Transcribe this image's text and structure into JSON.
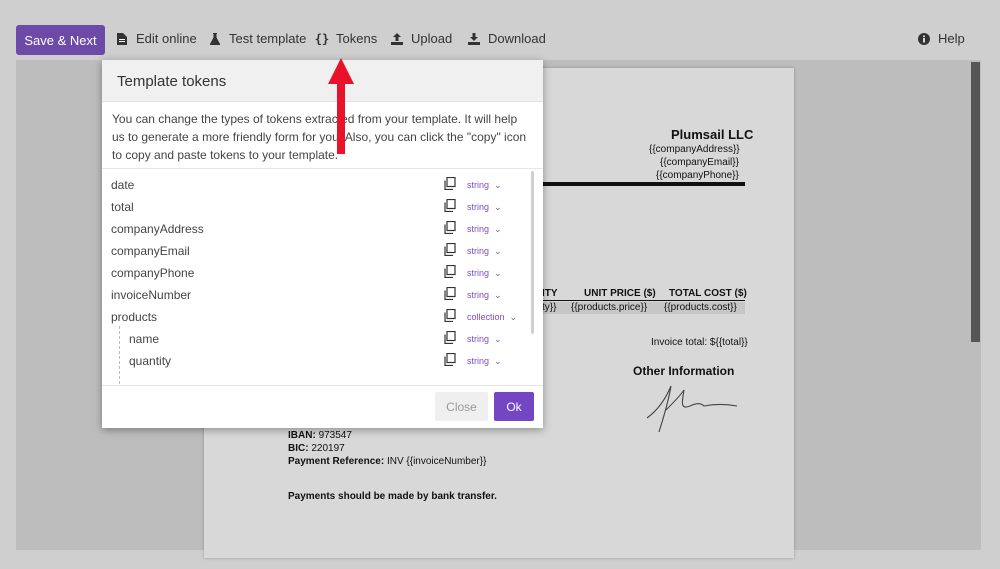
{
  "toolbar": {
    "save_next": "Save & Next",
    "edit_online": "Edit online",
    "test_template": "Test template",
    "tokens": "Tokens",
    "upload": "Upload",
    "download": "Download",
    "help": "Help"
  },
  "document": {
    "company": "Plumsail LLC",
    "address_token": "{{companyAddress}}",
    "email_token": "{{companyEmail}}",
    "phone_token": "{{companyPhone}}",
    "col_qty_fragment": "ITY",
    "col_unit_price": "UNIT PRICE ($)",
    "col_total_cost": "TOTAL COST ($)",
    "qty_cell_fragment": "ty}}",
    "price_token": "{{products.price}}",
    "cost_token": "{{products.cost}}",
    "invoice_total": "Invoice total: ${{total}}",
    "other_info": "Other Information",
    "iban_label": "IBAN:",
    "iban_value": "973547",
    "bic_label": "BIC:",
    "bic_value": "220197",
    "payref_label": "Payment Reference:",
    "payref_value": "INV {{invoiceNumber}}",
    "payment_note": "Payments should be made by bank transfer."
  },
  "dialog": {
    "title": "Template tokens",
    "description": "You can change the types of tokens extracted from your template. It will help us to generate a more friendly form for you. Also, you can click the \"copy\" icon to copy and paste tokens to your template.",
    "tokens": [
      {
        "name": "date",
        "type": "string"
      },
      {
        "name": "total",
        "type": "string"
      },
      {
        "name": "companyAddress",
        "type": "string"
      },
      {
        "name": "companyEmail",
        "type": "string"
      },
      {
        "name": "companyPhone",
        "type": "string"
      },
      {
        "name": "invoiceNumber",
        "type": "string"
      },
      {
        "name": "products",
        "type": "collection"
      },
      {
        "name": "name",
        "type": "string"
      },
      {
        "name": "quantity",
        "type": "string"
      }
    ],
    "close_label": "Close",
    "ok_label": "Ok"
  },
  "colors": {
    "accent": "#7446c4",
    "arrow": "#e8132b"
  }
}
